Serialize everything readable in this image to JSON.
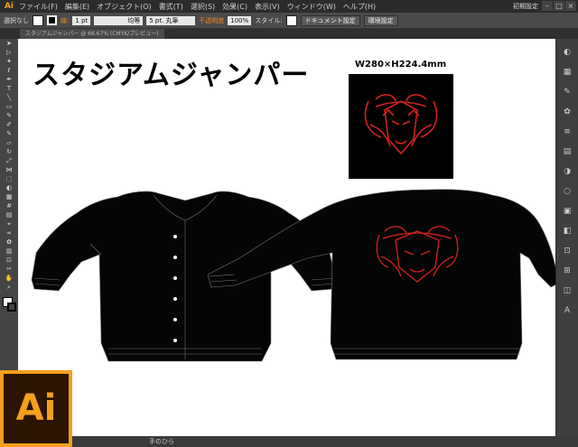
{
  "app": {
    "logo": "Ai"
  },
  "menu": [
    "ファイル(F)",
    "編集(E)",
    "オブジェクト(O)",
    "書式(T)",
    "選択(S)",
    "効果(C)",
    "表示(V)",
    "ウィンドウ(W)",
    "ヘルプ(H)"
  ],
  "workspace": "初期設定",
  "control": {
    "selection": "選択なし",
    "stroke_label": "線:",
    "stroke_weight": "1 pt",
    "uniform": "均等",
    "brush": "5 pt. 丸筆",
    "opacity_label": "不透明度",
    "opacity": "100%",
    "style_label": "スタイル:",
    "doc_setup": "ドキュメント設定",
    "env_setup": "環境設定"
  },
  "doc_tab": "スタジアムジャンパー @ 66.67% (CMYK/プレビュー)",
  "artwork": {
    "title": "スタジアムジャンパー",
    "dimensions": "W280×H224.4mm"
  },
  "status": {
    "tool": "手のひら"
  },
  "colors": {
    "accent": "#f4a01d",
    "emblem": "#d4211e",
    "jacket": "#050505"
  }
}
